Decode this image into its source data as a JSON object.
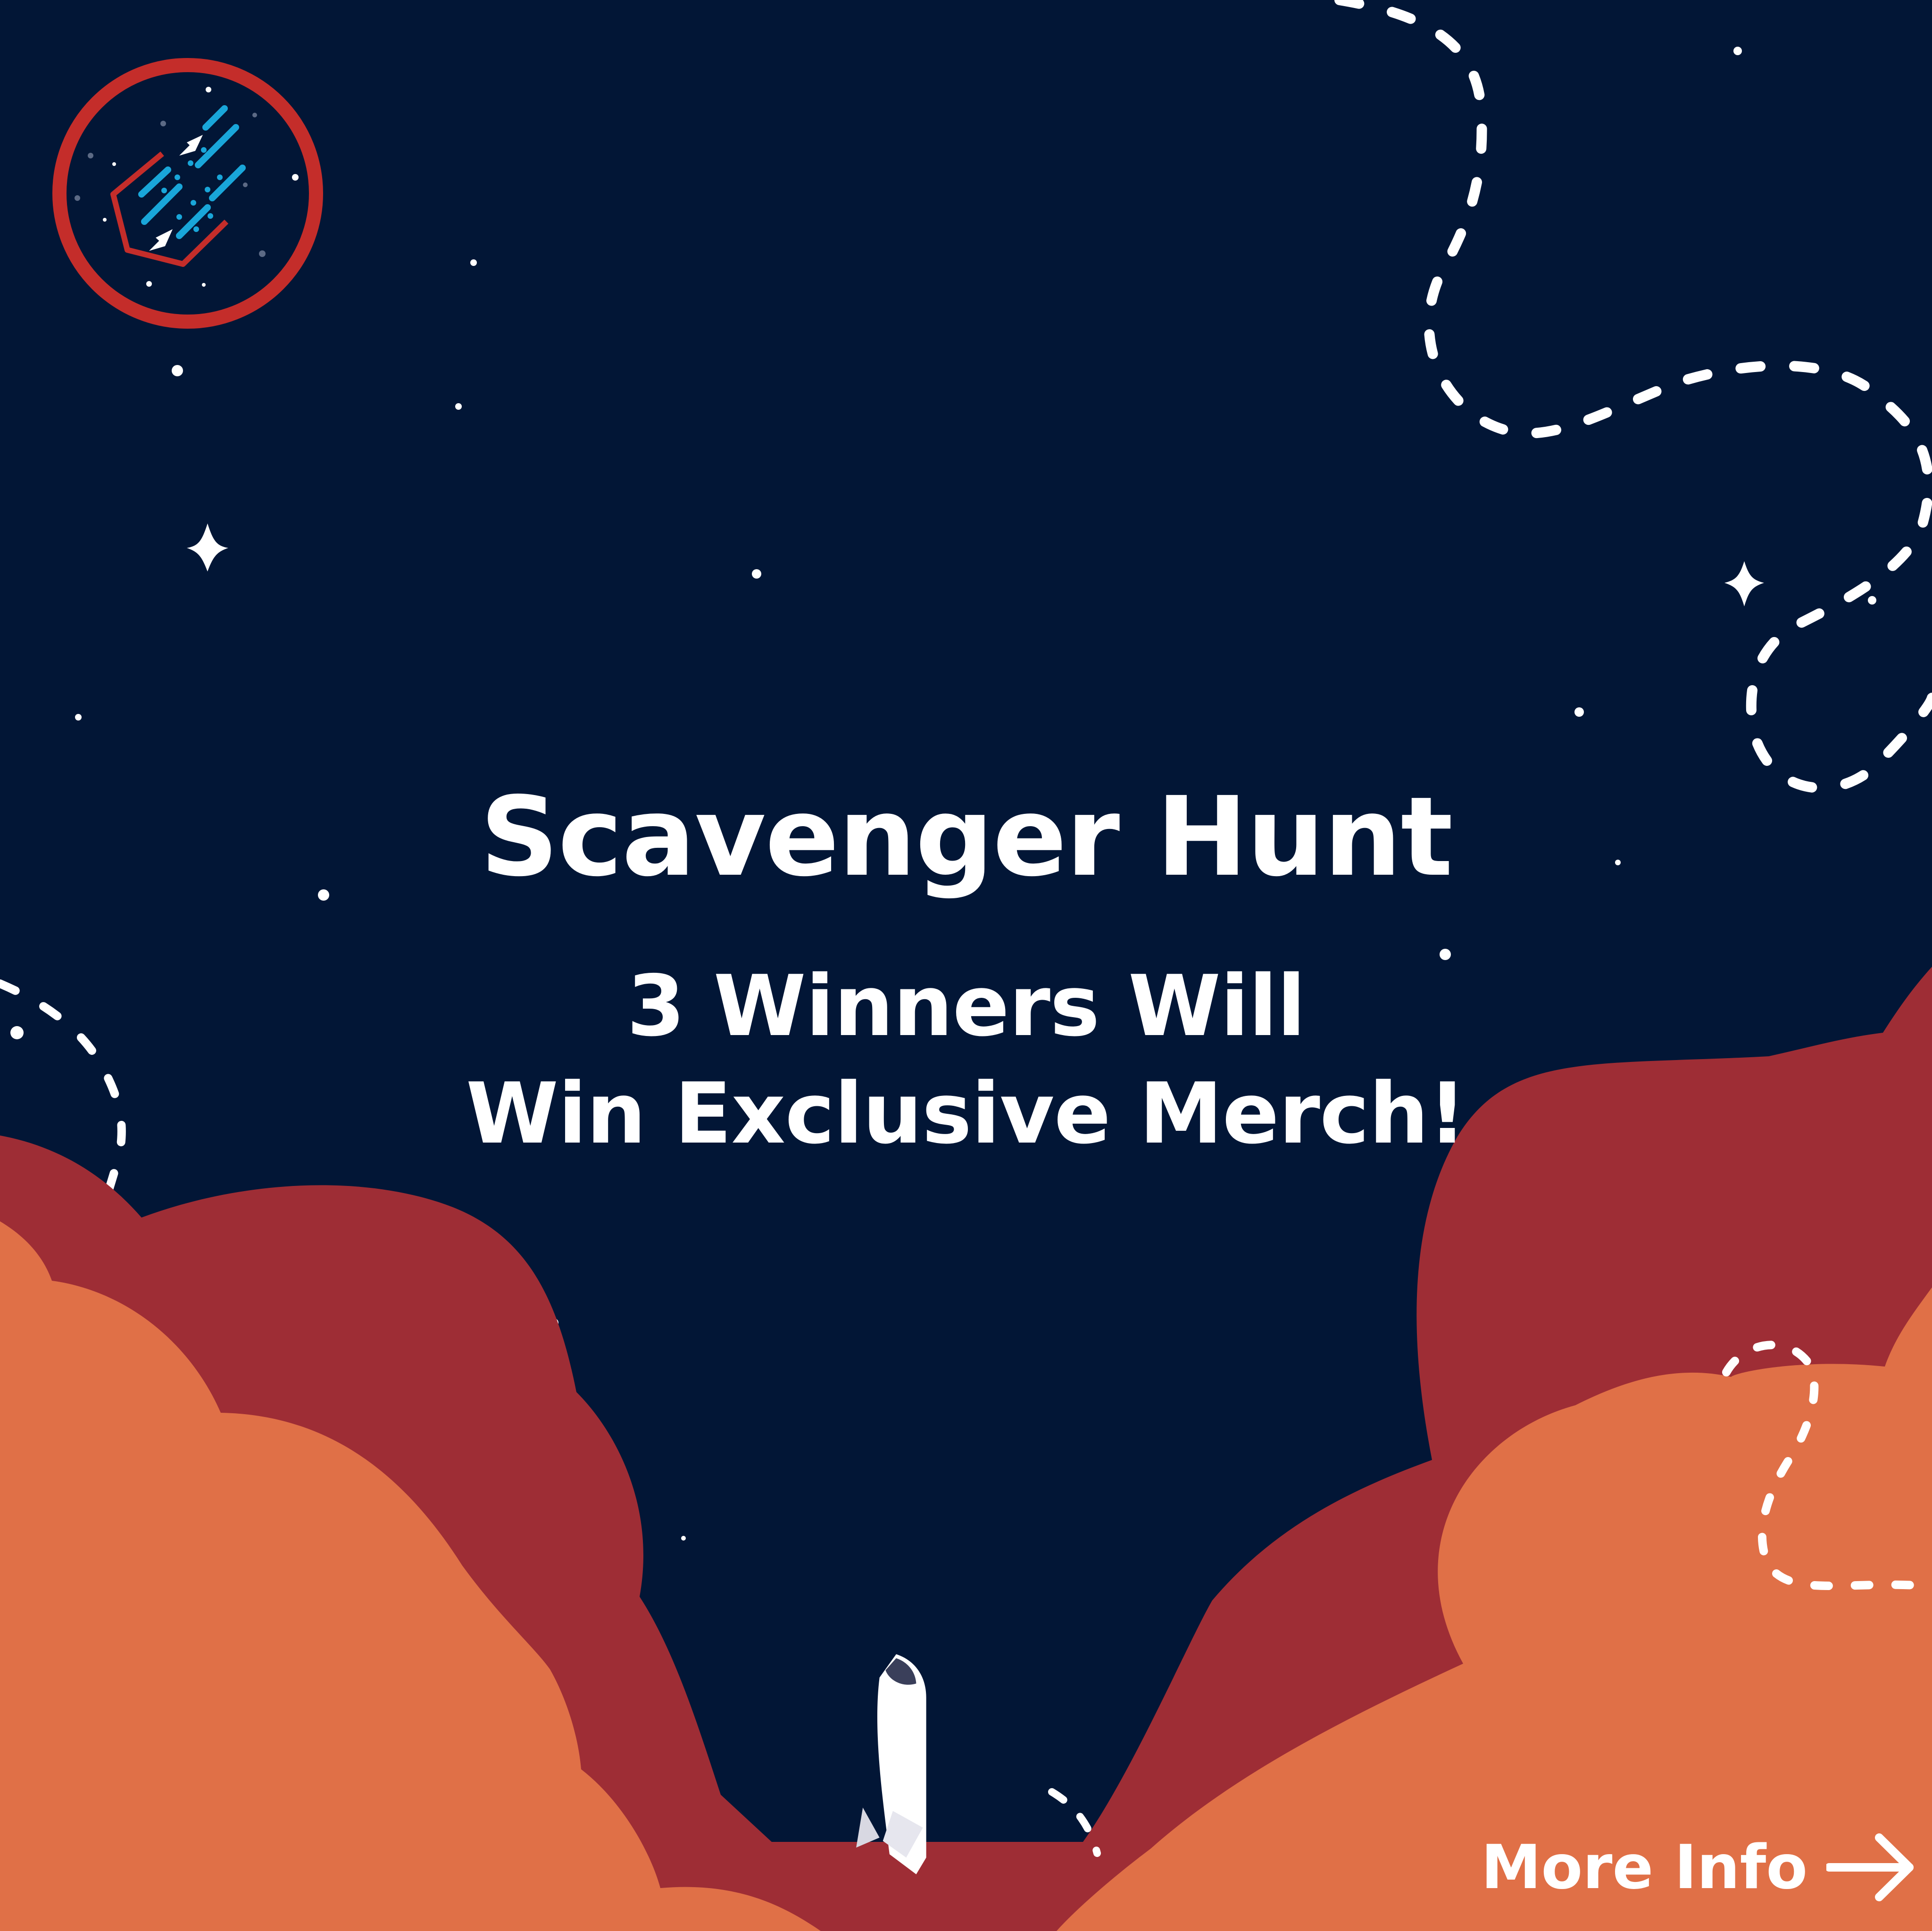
{
  "headline": {
    "title": "Scavenger Hunt",
    "subtitle_line1": "3 Winners Will",
    "subtitle_line2": "Win Exclusive Merch!"
  },
  "cta": {
    "label": "More Info",
    "icon": "arrow-right-icon"
  },
  "graphics": {
    "logo": "rocket-badge-logo",
    "rocket": "rocket-icon",
    "clouds": "cloud-layers",
    "path": "dashed-flight-path"
  },
  "colors": {
    "background": "#021636",
    "cloud_back": "#9E2D35",
    "cloud_front": "#E07047",
    "badge_ring": "#C42D2A",
    "badge_streaks": "#19A6D9",
    "text": "#FFFFFF"
  }
}
